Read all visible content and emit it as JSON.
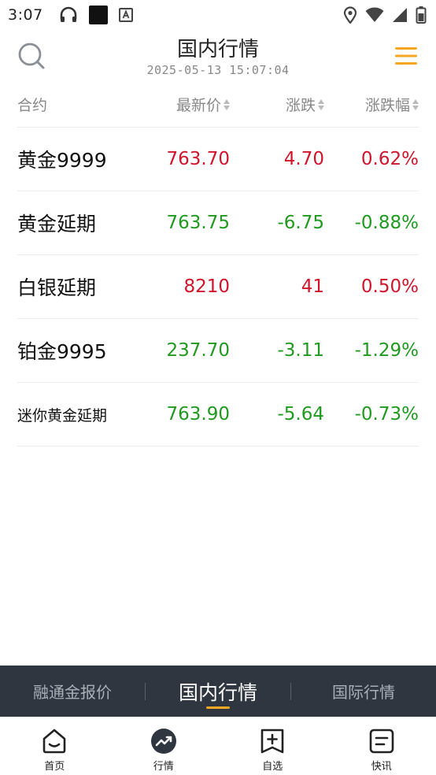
{
  "status": {
    "time": "3:07"
  },
  "header": {
    "title": "国内行情",
    "datetime": "2025-05-13 15:07:04"
  },
  "columns": {
    "name": "合约",
    "price": "最新价",
    "change": "涨跌",
    "pct": "涨跌幅"
  },
  "rows": [
    {
      "name": "黄金9999",
      "price": "763.70",
      "change": "4.70",
      "pct": "0.62%",
      "trend": "up"
    },
    {
      "name": "黄金延期",
      "price": "763.75",
      "change": "-6.75",
      "pct": "-0.88%",
      "trend": "down"
    },
    {
      "name": "白银延期",
      "price": "8210",
      "change": "41",
      "pct": "0.50%",
      "trend": "up"
    },
    {
      "name": "铂金9995",
      "price": "237.70",
      "change": "-3.11",
      "pct": "-1.29%",
      "trend": "down"
    },
    {
      "name": "迷你黄金延期",
      "price": "763.90",
      "change": "-5.64",
      "pct": "-0.73%",
      "trend": "down"
    }
  ],
  "tabs": [
    {
      "label": "融通金报价"
    },
    {
      "label": "国内行情"
    },
    {
      "label": "国际行情"
    }
  ],
  "nav": [
    {
      "label": "首页",
      "icon": "home-icon"
    },
    {
      "label": "行情",
      "icon": "trend-icon"
    },
    {
      "label": "自选",
      "icon": "add-favorite-icon"
    },
    {
      "label": "快讯",
      "icon": "news-icon"
    }
  ],
  "colors": {
    "up": "#d0142c",
    "down": "#1f9a1f",
    "accent": "#f5a623",
    "tab_bg": "#2f3640"
  }
}
